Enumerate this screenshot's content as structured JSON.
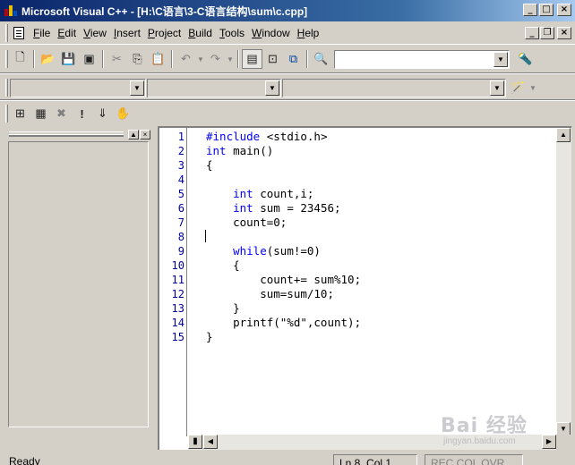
{
  "window": {
    "title": "Microsoft Visual C++ - [H:\\C语言\\3-C语言结构\\sum\\c.cpp]"
  },
  "menu": {
    "items": [
      {
        "label": "File",
        "key": "F"
      },
      {
        "label": "Edit",
        "key": "E"
      },
      {
        "label": "View",
        "key": "V"
      },
      {
        "label": "Insert",
        "key": "I"
      },
      {
        "label": "Project",
        "key": "P"
      },
      {
        "label": "Build",
        "key": "B"
      },
      {
        "label": "Tools",
        "key": "T"
      },
      {
        "label": "Window",
        "key": "W"
      },
      {
        "label": "Help",
        "key": "H"
      }
    ]
  },
  "toolbar": {
    "find_value": ""
  },
  "wizard_bar": {
    "class_value": "",
    "filter_value": "",
    "members_value": ""
  },
  "editor": {
    "line_numbers": [
      "1",
      "2",
      "3",
      "4",
      "5",
      "6",
      "7",
      "8",
      "9",
      "10",
      "11",
      "12",
      "13",
      "14",
      "15"
    ],
    "code_lines": [
      "#include <stdio.h>",
      "int main()",
      "{",
      "",
      "    int count,i;",
      "    int sum = 23456;",
      "    count=0;",
      "",
      "    while(sum!=0)",
      "    {",
      "        count+= sum%10;",
      "        sum=sum/10;",
      "    }",
      "    printf(\"%d\",count);",
      "}"
    ]
  },
  "status": {
    "message": "Ready",
    "position": "Ln 8, Col 1",
    "modes": "REC COL OVR"
  },
  "watermark": {
    "text": "Bai 经验",
    "subtext": "jingyan.baidu.com"
  },
  "colors": {
    "title_bar_start": "#0a246a",
    "title_bar_end": "#a6caf0",
    "keyword": "#0000ff",
    "line_number": "#0000a0",
    "chrome": "#d4d0c8"
  }
}
